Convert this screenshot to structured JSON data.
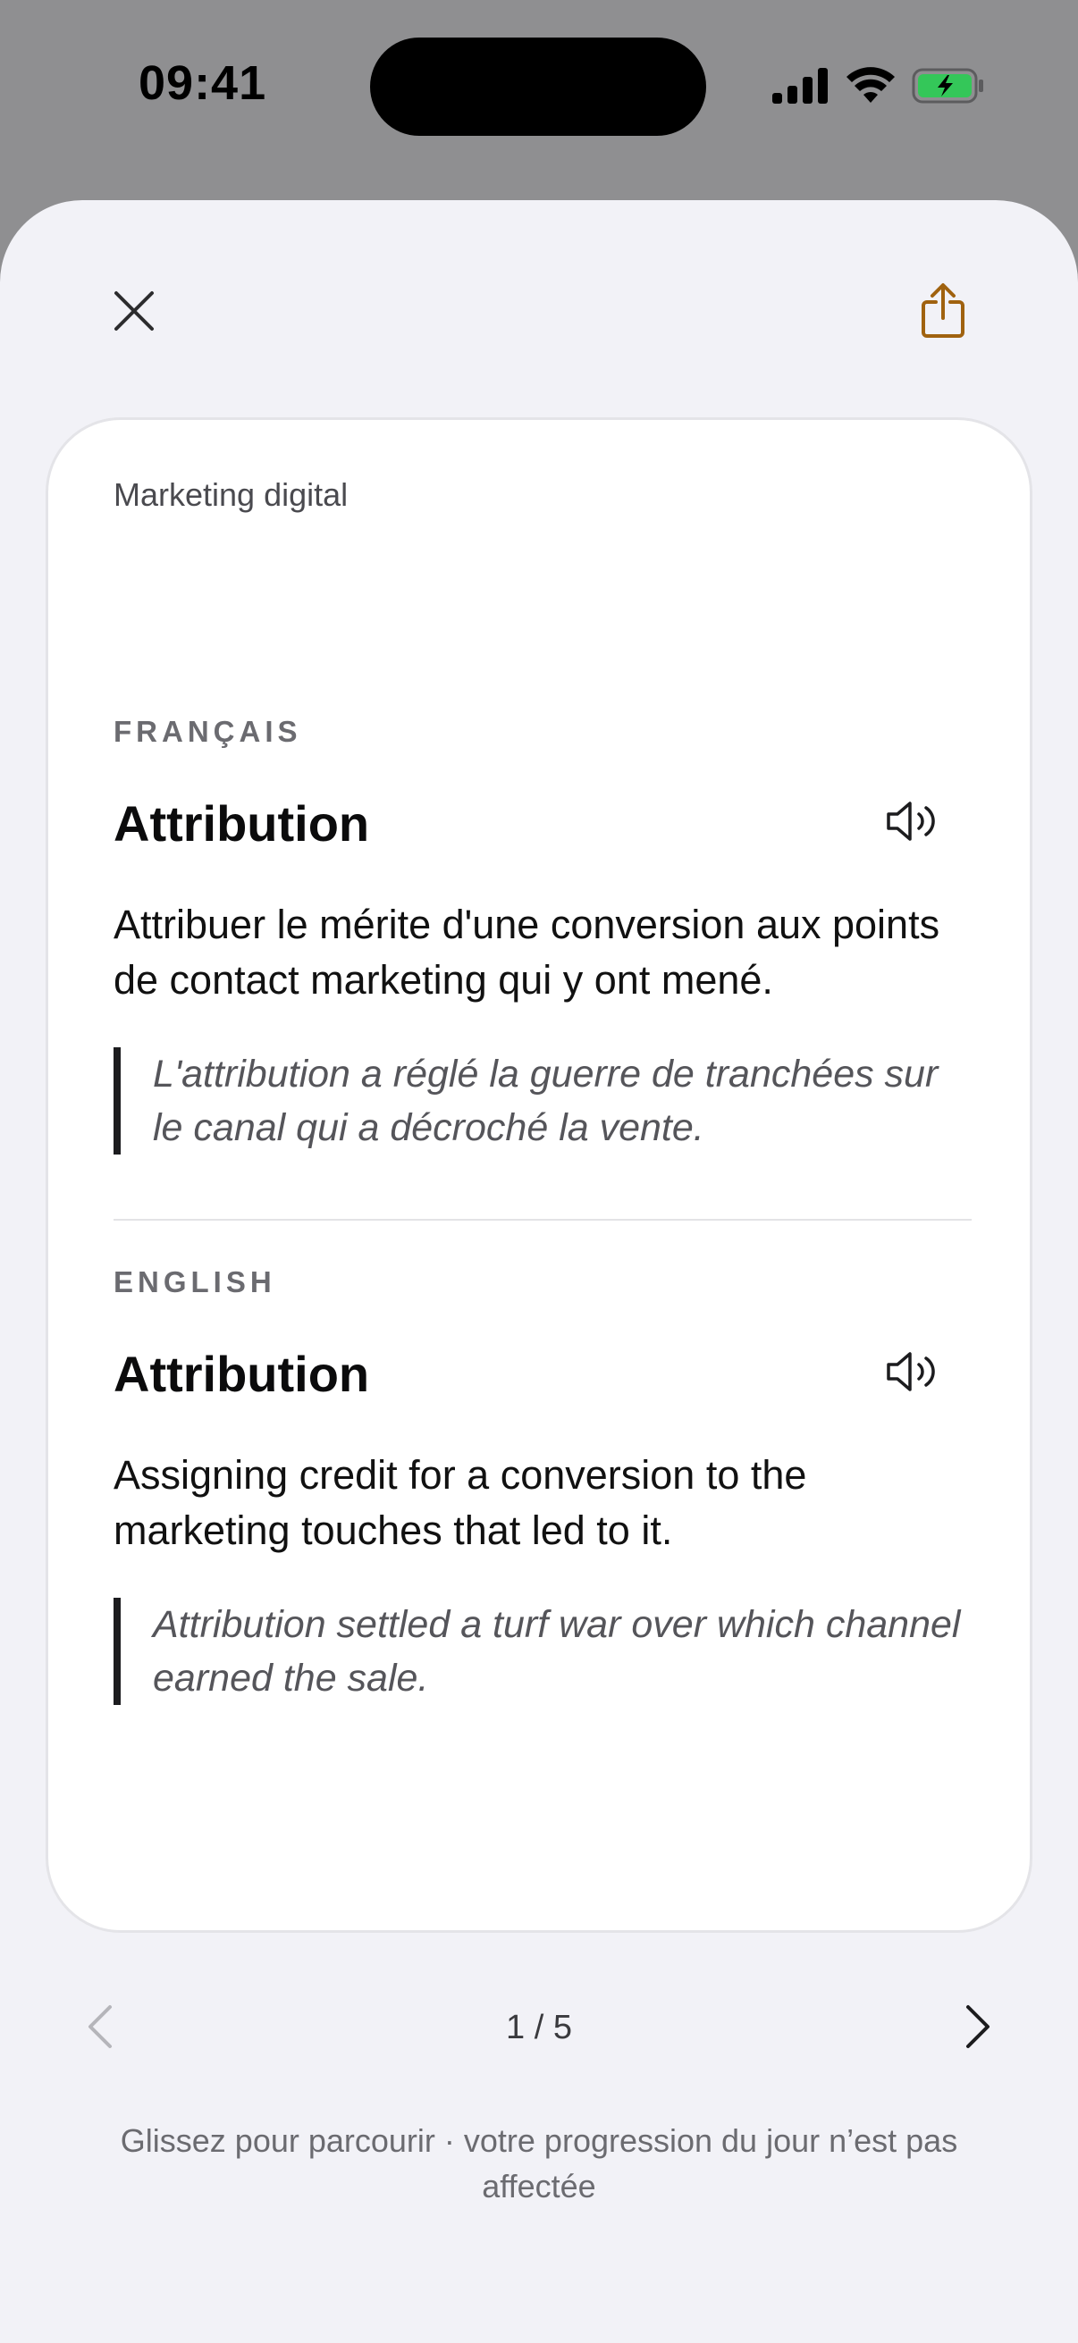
{
  "status_bar": {
    "time": "09:41",
    "icons": [
      "cellular-signal-icon",
      "wifi-icon",
      "battery-charging-icon"
    ],
    "battery_color": "#34c759"
  },
  "header": {
    "close_icon": "close-icon",
    "share_icon": "share-icon",
    "accent_color": "#a0620f"
  },
  "card": {
    "category": "Marketing digital",
    "french": {
      "label": "FRANÇAIS",
      "term": "Attribution",
      "definition": "Attribuer le mérite d'une conversion aux points de contact marketing qui y ont mené.",
      "example": "L'attribution a réglé la guerre de tranchées sur le canal qui a décroché la vente."
    },
    "english": {
      "label": "ENGLISH",
      "term": "Attribution",
      "definition": "Assigning credit for a conversion to the marketing touches that led to it.",
      "example": "Attribution settled a turf war over which channel earned the sale."
    }
  },
  "pagination": {
    "indicator": "1 / 5",
    "prev_enabled": false,
    "next_enabled": true
  },
  "hint": "Glissez pour parcourir · votre progression du jour n’est pas affectée"
}
